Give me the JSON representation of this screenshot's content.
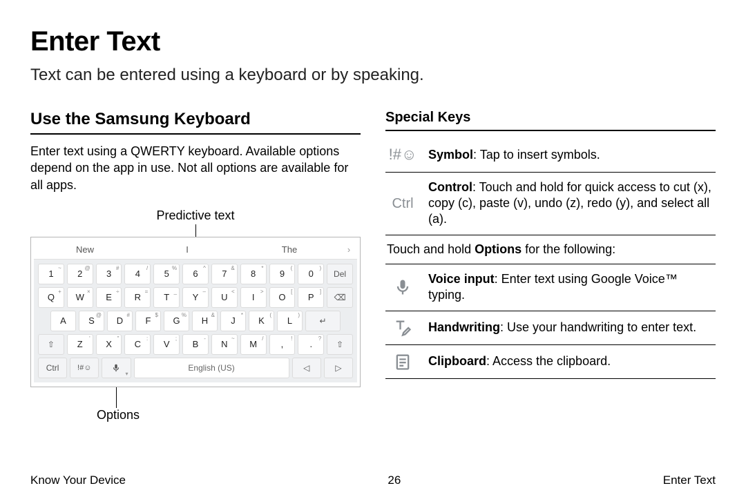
{
  "title": "Enter Text",
  "intro": "Text can be entered using a keyboard or by speaking.",
  "left": {
    "heading": "Use the Samsung Keyboard",
    "body": "Enter text using a QWERTY keyboard. Available options depend on the app in use. Not all options are available for all apps.",
    "callout_predictive": "Predictive text",
    "callout_options": "Options",
    "keyboard": {
      "predictions": [
        "New",
        "I",
        "The"
      ],
      "row1": [
        {
          "k": "1",
          "s": "~"
        },
        {
          "k": "2",
          "s": "@"
        },
        {
          "k": "3",
          "s": "#"
        },
        {
          "k": "4",
          "s": "/"
        },
        {
          "k": "5",
          "s": "%"
        },
        {
          "k": "6",
          "s": "^"
        },
        {
          "k": "7",
          "s": "&"
        },
        {
          "k": "8",
          "s": "*"
        },
        {
          "k": "9",
          "s": "("
        },
        {
          "k": "0",
          "s": ")"
        },
        {
          "k": "Del",
          "func": true
        }
      ],
      "row2": [
        {
          "k": "Q",
          "s": "+"
        },
        {
          "k": "W",
          "s": "×"
        },
        {
          "k": "E",
          "s": "÷"
        },
        {
          "k": "R",
          "s": "="
        },
        {
          "k": "T",
          "s": "_"
        },
        {
          "k": "Y",
          "s": "–"
        },
        {
          "k": "U",
          "s": "<"
        },
        {
          "k": "I",
          "s": ">"
        },
        {
          "k": "O",
          "s": "["
        },
        {
          "k": "P",
          "s": "]"
        },
        {
          "k": "⌫",
          "func": true
        }
      ],
      "row3": [
        {
          "k": "A",
          "s": ""
        },
        {
          "k": "S",
          "s": "@"
        },
        {
          "k": "D",
          "s": "#"
        },
        {
          "k": "F",
          "s": "$"
        },
        {
          "k": "G",
          "s": "%"
        },
        {
          "k": "H",
          "s": "&"
        },
        {
          "k": "J",
          "s": "*"
        },
        {
          "k": "K",
          "s": "("
        },
        {
          "k": "L",
          "s": ")"
        },
        {
          "k": "↵",
          "func": true,
          "wide": true
        }
      ],
      "row4": [
        {
          "k": "⇧",
          "func": true
        },
        {
          "k": "Z",
          "s": "'"
        },
        {
          "k": "X",
          "s": "\""
        },
        {
          "k": "C",
          "s": ":"
        },
        {
          "k": "V",
          "s": ";"
        },
        {
          "k": "B",
          "s": "-"
        },
        {
          "k": "N",
          "s": "~"
        },
        {
          "k": "M",
          "s": "/"
        },
        {
          "k": ",",
          "s": "!"
        },
        {
          "k": ".",
          "s": "?"
        },
        {
          "k": "⇧",
          "func": true
        }
      ],
      "row5": {
        "ctrl": "Ctrl",
        "sym": "!#☺",
        "mic": "🎤",
        "space": "English (US)",
        "left": "◁",
        "right": "▷"
      }
    }
  },
  "right": {
    "heading": "Special Keys",
    "rows": [
      {
        "icon": "symbol",
        "bold": "Symbol",
        "text": ": Tap to insert symbols."
      },
      {
        "icon": "ctrl",
        "bold": "Control",
        "text": ": Touch and hold for quick access to cut (x), copy (c), paste (v), undo (z), redo (y), and select all (a)."
      }
    ],
    "options_intro_a": "Touch and hold ",
    "options_intro_b": "Options",
    "options_intro_c": " for the following:",
    "option_rows": [
      {
        "icon": "mic",
        "bold": "Voice input",
        "text": ": Enter text using Google Voice™ typing."
      },
      {
        "icon": "handwriting",
        "bold": "Handwriting",
        "text": ": Use your handwriting to enter text."
      },
      {
        "icon": "clipboard",
        "bold": "Clipboard",
        "text": ": Access the clipboard."
      }
    ]
  },
  "footer": {
    "left": "Know Your Device",
    "center": "26",
    "right": "Enter Text"
  }
}
